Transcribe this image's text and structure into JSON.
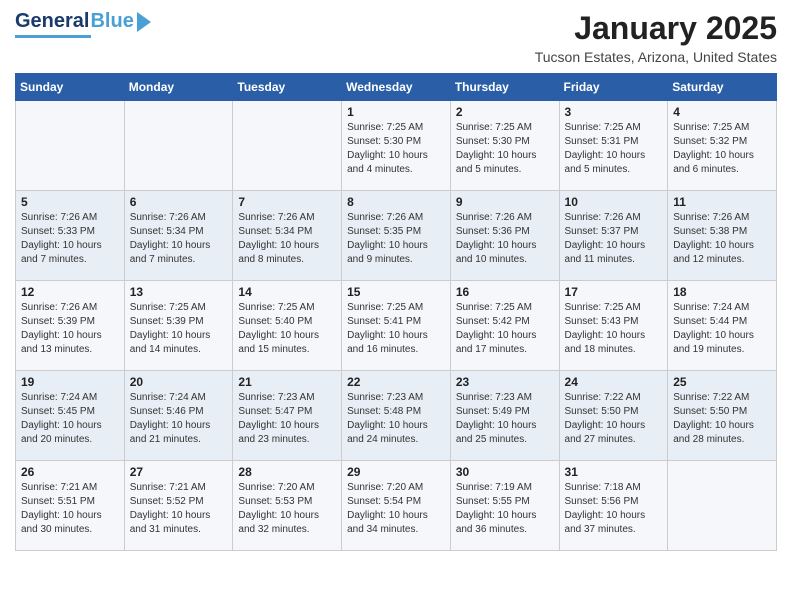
{
  "header": {
    "logo": {
      "general": "General",
      "blue": "Blue",
      "triangle": "▶"
    },
    "title": "January 2025",
    "location": "Tucson Estates, Arizona, United States"
  },
  "weekdays": [
    "Sunday",
    "Monday",
    "Tuesday",
    "Wednesday",
    "Thursday",
    "Friday",
    "Saturday"
  ],
  "weeks": [
    [
      {
        "day": "",
        "sunrise": "",
        "sunset": "",
        "daylight": ""
      },
      {
        "day": "",
        "sunrise": "",
        "sunset": "",
        "daylight": ""
      },
      {
        "day": "",
        "sunrise": "",
        "sunset": "",
        "daylight": ""
      },
      {
        "day": "1",
        "sunrise": "Sunrise: 7:25 AM",
        "sunset": "Sunset: 5:30 PM",
        "daylight": "Daylight: 10 hours and 4 minutes."
      },
      {
        "day": "2",
        "sunrise": "Sunrise: 7:25 AM",
        "sunset": "Sunset: 5:30 PM",
        "daylight": "Daylight: 10 hours and 5 minutes."
      },
      {
        "day": "3",
        "sunrise": "Sunrise: 7:25 AM",
        "sunset": "Sunset: 5:31 PM",
        "daylight": "Daylight: 10 hours and 5 minutes."
      },
      {
        "day": "4",
        "sunrise": "Sunrise: 7:25 AM",
        "sunset": "Sunset: 5:32 PM",
        "daylight": "Daylight: 10 hours and 6 minutes."
      }
    ],
    [
      {
        "day": "5",
        "sunrise": "Sunrise: 7:26 AM",
        "sunset": "Sunset: 5:33 PM",
        "daylight": "Daylight: 10 hours and 7 minutes."
      },
      {
        "day": "6",
        "sunrise": "Sunrise: 7:26 AM",
        "sunset": "Sunset: 5:34 PM",
        "daylight": "Daylight: 10 hours and 7 minutes."
      },
      {
        "day": "7",
        "sunrise": "Sunrise: 7:26 AM",
        "sunset": "Sunset: 5:34 PM",
        "daylight": "Daylight: 10 hours and 8 minutes."
      },
      {
        "day": "8",
        "sunrise": "Sunrise: 7:26 AM",
        "sunset": "Sunset: 5:35 PM",
        "daylight": "Daylight: 10 hours and 9 minutes."
      },
      {
        "day": "9",
        "sunrise": "Sunrise: 7:26 AM",
        "sunset": "Sunset: 5:36 PM",
        "daylight": "Daylight: 10 hours and 10 minutes."
      },
      {
        "day": "10",
        "sunrise": "Sunrise: 7:26 AM",
        "sunset": "Sunset: 5:37 PM",
        "daylight": "Daylight: 10 hours and 11 minutes."
      },
      {
        "day": "11",
        "sunrise": "Sunrise: 7:26 AM",
        "sunset": "Sunset: 5:38 PM",
        "daylight": "Daylight: 10 hours and 12 minutes."
      }
    ],
    [
      {
        "day": "12",
        "sunrise": "Sunrise: 7:26 AM",
        "sunset": "Sunset: 5:39 PM",
        "daylight": "Daylight: 10 hours and 13 minutes."
      },
      {
        "day": "13",
        "sunrise": "Sunrise: 7:25 AM",
        "sunset": "Sunset: 5:39 PM",
        "daylight": "Daylight: 10 hours and 14 minutes."
      },
      {
        "day": "14",
        "sunrise": "Sunrise: 7:25 AM",
        "sunset": "Sunset: 5:40 PM",
        "daylight": "Daylight: 10 hours and 15 minutes."
      },
      {
        "day": "15",
        "sunrise": "Sunrise: 7:25 AM",
        "sunset": "Sunset: 5:41 PM",
        "daylight": "Daylight: 10 hours and 16 minutes."
      },
      {
        "day": "16",
        "sunrise": "Sunrise: 7:25 AM",
        "sunset": "Sunset: 5:42 PM",
        "daylight": "Daylight: 10 hours and 17 minutes."
      },
      {
        "day": "17",
        "sunrise": "Sunrise: 7:25 AM",
        "sunset": "Sunset: 5:43 PM",
        "daylight": "Daylight: 10 hours and 18 minutes."
      },
      {
        "day": "18",
        "sunrise": "Sunrise: 7:24 AM",
        "sunset": "Sunset: 5:44 PM",
        "daylight": "Daylight: 10 hours and 19 minutes."
      }
    ],
    [
      {
        "day": "19",
        "sunrise": "Sunrise: 7:24 AM",
        "sunset": "Sunset: 5:45 PM",
        "daylight": "Daylight: 10 hours and 20 minutes."
      },
      {
        "day": "20",
        "sunrise": "Sunrise: 7:24 AM",
        "sunset": "Sunset: 5:46 PM",
        "daylight": "Daylight: 10 hours and 21 minutes."
      },
      {
        "day": "21",
        "sunrise": "Sunrise: 7:23 AM",
        "sunset": "Sunset: 5:47 PM",
        "daylight": "Daylight: 10 hours and 23 minutes."
      },
      {
        "day": "22",
        "sunrise": "Sunrise: 7:23 AM",
        "sunset": "Sunset: 5:48 PM",
        "daylight": "Daylight: 10 hours and 24 minutes."
      },
      {
        "day": "23",
        "sunrise": "Sunrise: 7:23 AM",
        "sunset": "Sunset: 5:49 PM",
        "daylight": "Daylight: 10 hours and 25 minutes."
      },
      {
        "day": "24",
        "sunrise": "Sunrise: 7:22 AM",
        "sunset": "Sunset: 5:50 PM",
        "daylight": "Daylight: 10 hours and 27 minutes."
      },
      {
        "day": "25",
        "sunrise": "Sunrise: 7:22 AM",
        "sunset": "Sunset: 5:50 PM",
        "daylight": "Daylight: 10 hours and 28 minutes."
      }
    ],
    [
      {
        "day": "26",
        "sunrise": "Sunrise: 7:21 AM",
        "sunset": "Sunset: 5:51 PM",
        "daylight": "Daylight: 10 hours and 30 minutes."
      },
      {
        "day": "27",
        "sunrise": "Sunrise: 7:21 AM",
        "sunset": "Sunset: 5:52 PM",
        "daylight": "Daylight: 10 hours and 31 minutes."
      },
      {
        "day": "28",
        "sunrise": "Sunrise: 7:20 AM",
        "sunset": "Sunset: 5:53 PM",
        "daylight": "Daylight: 10 hours and 32 minutes."
      },
      {
        "day": "29",
        "sunrise": "Sunrise: 7:20 AM",
        "sunset": "Sunset: 5:54 PM",
        "daylight": "Daylight: 10 hours and 34 minutes."
      },
      {
        "day": "30",
        "sunrise": "Sunrise: 7:19 AM",
        "sunset": "Sunset: 5:55 PM",
        "daylight": "Daylight: 10 hours and 36 minutes."
      },
      {
        "day": "31",
        "sunrise": "Sunrise: 7:18 AM",
        "sunset": "Sunset: 5:56 PM",
        "daylight": "Daylight: 10 hours and 37 minutes."
      },
      {
        "day": "",
        "sunrise": "",
        "sunset": "",
        "daylight": ""
      }
    ]
  ]
}
